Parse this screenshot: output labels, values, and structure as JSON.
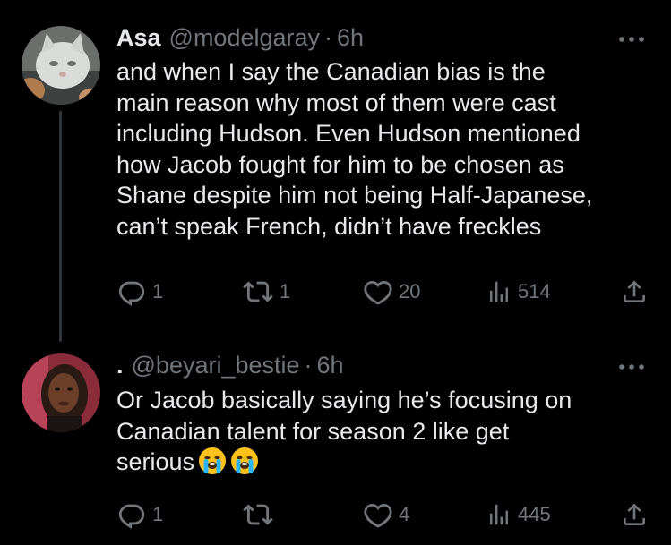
{
  "colors": {
    "background": "#000000",
    "text_primary": "#e7e9ea",
    "text_secondary": "#71767b",
    "thread_line": "#333639"
  },
  "tweets": [
    {
      "display_name": "Asa",
      "handle": "@modelgaray",
      "separator": "·",
      "time": "6h",
      "text": "and when I say the Canadian bias is the\nmain reason why most of them were cast\nincluding Hudson. Even Hudson mentioned\nhow Jacob fought for him to be chosen as\nShane despite him not being Half-Japanese,\ncan’t speak French, didn’t have freckles",
      "emojis": [],
      "replies": "1",
      "reposts": "1",
      "likes": "20",
      "views": "514"
    },
    {
      "display_name": ".",
      "handle": "@beyari_bestie",
      "separator": "·",
      "time": "6h",
      "text": "Or Jacob basically saying he’s focusing on\nCanadian talent for season 2 like get\nserious",
      "emojis": [
        "loudly-crying-face",
        "loudly-crying-face"
      ],
      "replies": "1",
      "reposts": "",
      "likes": "4",
      "views": "445"
    }
  ],
  "icons": {
    "more": "more-horizontal-icon",
    "reply": "reply-icon",
    "repost": "repost-icon",
    "like": "heart-icon",
    "views": "views-chart-icon",
    "share": "share-icon"
  }
}
